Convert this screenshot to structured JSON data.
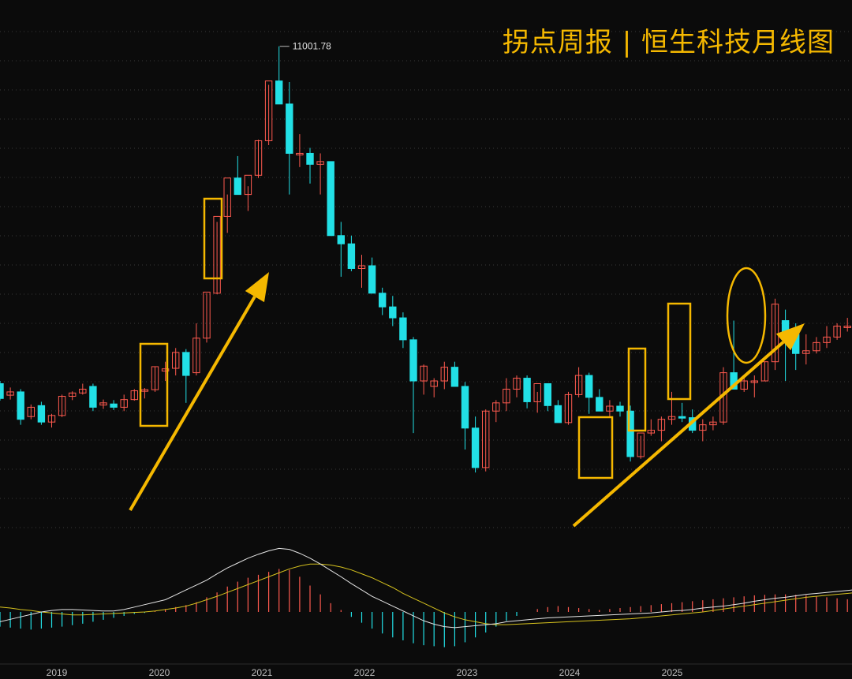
{
  "header": {
    "title": "拐点周报 | 恒生科技月线图"
  },
  "colors": {
    "background": "#0b0b0b",
    "up": "#ff5a4f",
    "down": "#22e0e6",
    "annotation": "#f5b800",
    "dif_line": "#e6e6e6",
    "dea_line": "#d6c21e",
    "grid": "#3a3a3a"
  },
  "chart_data": {
    "type": "candlestick",
    "title": "拐点周报 | 恒生科技月线图",
    "x_ticks": [
      "2019",
      "2020",
      "2021",
      "2022",
      "2023",
      "2024",
      "2025"
    ],
    "peak_label": "11001.78",
    "peak_value": 11001.78,
    "ylim": [
      2700,
      11300
    ],
    "grid": true,
    "series": [
      {
        "name": "price",
        "ohlc": [
          [
            4850,
            4900,
            4540,
            4580
          ],
          [
            4640,
            4780,
            4560,
            4700
          ],
          [
            4700,
            4750,
            4100,
            4200
          ],
          [
            4250,
            4470,
            4200,
            4420
          ],
          [
            4450,
            4520,
            4100,
            4150
          ],
          [
            4150,
            4300,
            4050,
            4270
          ],
          [
            4270,
            4650,
            4240,
            4620
          ],
          [
            4620,
            4710,
            4550,
            4680
          ],
          [
            4680,
            4850,
            4650,
            4750
          ],
          [
            4800,
            4850,
            4350,
            4420
          ],
          [
            4460,
            4560,
            4390,
            4500
          ],
          [
            4480,
            4550,
            4370,
            4420
          ],
          [
            4420,
            4650,
            4350,
            4560
          ],
          [
            4560,
            4750,
            4540,
            4720
          ],
          [
            4720,
            4770,
            4580,
            4740
          ],
          [
            4740,
            5160,
            4700,
            5160
          ],
          [
            5080,
            5250,
            4900,
            5120
          ],
          [
            5130,
            5500,
            5000,
            5420
          ],
          [
            5420,
            5480,
            4500,
            5000
          ],
          [
            5050,
            5950,
            5000,
            5680
          ],
          [
            5680,
            6500,
            5600,
            6520
          ],
          [
            6500,
            7800,
            6480,
            7900
          ],
          [
            7900,
            8300,
            7600,
            8600
          ],
          [
            8600,
            9000,
            8300,
            8300
          ],
          [
            8300,
            8450,
            8000,
            8650
          ],
          [
            8650,
            9300,
            8600,
            9280
          ],
          [
            9280,
            10300,
            9200,
            10370
          ],
          [
            10370,
            11001.78,
            9950,
            9950
          ],
          [
            9950,
            10350,
            8300,
            9050
          ],
          [
            9050,
            9400,
            8800,
            9050
          ],
          [
            9050,
            9150,
            8500,
            8850
          ],
          [
            8850,
            9050,
            8300,
            8900
          ],
          [
            8900,
            8900,
            7550,
            7550
          ],
          [
            7550,
            7800,
            6800,
            7400
          ],
          [
            7400,
            7550,
            6900,
            6950
          ],
          [
            6950,
            7200,
            6600,
            7000
          ],
          [
            7000,
            7150,
            6600,
            6500
          ],
          [
            6500,
            6600,
            6100,
            6250
          ],
          [
            6250,
            6450,
            5900,
            6050
          ],
          [
            6050,
            6150,
            5500,
            5650
          ],
          [
            5650,
            5700,
            3950,
            4900
          ],
          [
            4900,
            5200,
            4650,
            5170
          ],
          [
            4800,
            4950,
            4600,
            4900
          ],
          [
            4900,
            5250,
            4750,
            5150
          ],
          [
            5150,
            5250,
            4800,
            4800
          ],
          [
            4800,
            4880,
            3650,
            4040
          ],
          [
            4040,
            4250,
            3230,
            3320
          ],
          [
            3320,
            4380,
            3250,
            4350
          ],
          [
            4350,
            4550,
            4150,
            4500
          ],
          [
            4500,
            4950,
            4350,
            4750
          ],
          [
            4750,
            5000,
            4600,
            4950
          ],
          [
            4950,
            5000,
            4400,
            4520
          ],
          [
            4520,
            4700,
            4320,
            4850
          ],
          [
            4850,
            4750,
            4350,
            4450
          ],
          [
            4450,
            4550,
            4150,
            4140
          ],
          [
            4140,
            4700,
            4100,
            4650
          ],
          [
            4650,
            5150,
            4600,
            5000
          ],
          [
            5000,
            5050,
            4300,
            4600
          ],
          [
            4600,
            4750,
            4350,
            4350
          ],
          [
            4350,
            4550,
            4250,
            4440
          ],
          [
            4440,
            4520,
            4250,
            4350
          ],
          [
            4350,
            4450,
            3430,
            3520
          ],
          [
            3520,
            3900,
            3480,
            3950
          ],
          [
            3950,
            4200,
            3900,
            4000
          ],
          [
            4000,
            4250,
            3800,
            4200
          ],
          [
            4200,
            4700,
            4100,
            4250
          ],
          [
            4250,
            4500,
            4150,
            4230
          ],
          [
            4230,
            4380,
            3950,
            4000
          ],
          [
            4000,
            4200,
            3800,
            4100
          ],
          [
            4100,
            4250,
            4000,
            4150
          ],
          [
            4150,
            5150,
            4100,
            5050
          ],
          [
            5050,
            6000,
            4800,
            4750
          ],
          [
            4750,
            5000,
            4700,
            4900
          ],
          [
            4900,
            5000,
            4600,
            4900
          ],
          [
            4900,
            5250,
            4900,
            5250
          ],
          [
            5250,
            6400,
            5100,
            6300
          ],
          [
            6000,
            6200,
            4900,
            5750
          ],
          [
            5750,
            5950,
            5100,
            5400
          ],
          [
            5400,
            5750,
            5200,
            5450
          ],
          [
            5450,
            5700,
            5400,
            5600
          ],
          [
            5600,
            5900,
            5500,
            5700
          ],
          [
            5700,
            5950,
            5650,
            5900
          ],
          [
            5900,
            6050,
            5800,
            5900
          ],
          [
            5900,
            6800,
            5900,
            6650
          ],
          [
            6650,
            6720,
            6000,
            6150
          ],
          [
            6150,
            6300,
            5700,
            5820
          ],
          [
            5820,
            5900,
            5760,
            5870
          ]
        ]
      },
      {
        "name": "macd_hist",
        "values": [
          -30,
          -32,
          -34,
          -36,
          -34,
          -32,
          -30,
          -27,
          -24,
          -20,
          -16,
          -12,
          -8,
          -4,
          -2,
          2,
          6,
          10,
          14,
          20,
          30,
          40,
          52,
          62,
          70,
          76,
          82,
          88,
          86,
          72,
          54,
          36,
          18,
          4,
          -10,
          -22,
          -34,
          -44,
          -52,
          -58,
          -64,
          -68,
          -70,
          -72,
          -70,
          -62,
          -52,
          -42,
          -30,
          -18,
          -8,
          0,
          6,
          10,
          12,
          10,
          8,
          6,
          4,
          6,
          8,
          10,
          12,
          14,
          16,
          18,
          20,
          22,
          24,
          26,
          28,
          30,
          32,
          34,
          35,
          36,
          36,
          35,
          34,
          32,
          30,
          28,
          26,
          24,
          22,
          20,
          18
        ]
      },
      {
        "name": "dif",
        "values": [
          -20,
          -15,
          -10,
          -5,
          0,
          3,
          5,
          5,
          4,
          3,
          2,
          2,
          5,
          10,
          15,
          20,
          25,
          35,
          45,
          55,
          65,
          78,
          90,
          100,
          110,
          118,
          125,
          130,
          128,
          120,
          110,
          98,
          85,
          72,
          58,
          45,
          32,
          22,
          12,
          2,
          -8,
          -18,
          -25,
          -30,
          -32,
          -30,
          -28,
          -26,
          -24,
          -20,
          -18,
          -16,
          -14,
          -12,
          -11,
          -10,
          -9,
          -8,
          -7,
          -6,
          -5,
          -4,
          -3,
          -2,
          0,
          2,
          3,
          5,
          8,
          10,
          12,
          15,
          18,
          22,
          25,
          28,
          30,
          33,
          36,
          38,
          40,
          42,
          44,
          46,
          47,
          47,
          46
        ]
      },
      {
        "name": "dea",
        "values": [
          10,
          8,
          5,
          3,
          0,
          -2,
          -4,
          -6,
          -6,
          -5,
          -4,
          -3,
          -2,
          -1,
          0,
          2,
          5,
          8,
          12,
          18,
          25,
          32,
          40,
          48,
          56,
          64,
          72,
          80,
          88,
          94,
          98,
          98,
          96,
          92,
          86,
          78,
          70,
          60,
          50,
          38,
          28,
          18,
          8,
          -2,
          -10,
          -16,
          -20,
          -24,
          -26,
          -26,
          -25,
          -24,
          -23,
          -22,
          -21,
          -20,
          -19,
          -18,
          -17,
          -16,
          -15,
          -14,
          -12,
          -10,
          -8,
          -6,
          -4,
          -2,
          0,
          3,
          6,
          9,
          12,
          15,
          18,
          21,
          24,
          27,
          30,
          32,
          34,
          36,
          38,
          40,
          41,
          42,
          42
        ]
      }
    ]
  },
  "annotations": {
    "boxes": [
      "box-2020",
      "box-2020-mid",
      "box-2024-early",
      "box-2024-mid",
      "box-2024-late"
    ],
    "ellipse": "ellipse-2025",
    "arrows": [
      "arrow-2020-up",
      "arrow-2024-up"
    ]
  }
}
